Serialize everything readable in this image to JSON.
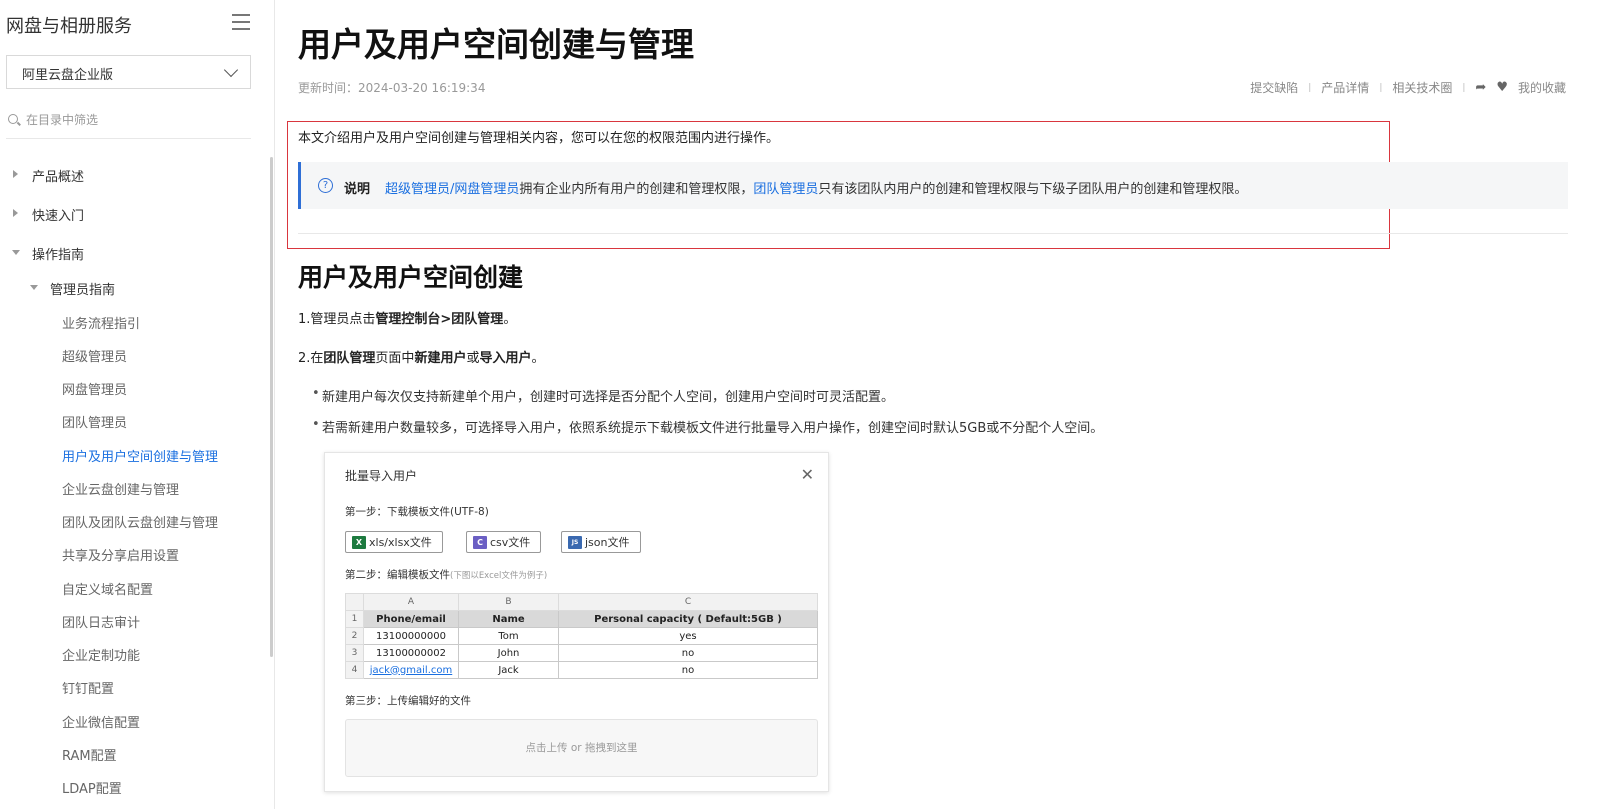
{
  "sidebar": {
    "title": "网盘与相册服务",
    "product_select": "阿里云盘企业版",
    "filter_placeholder": "在目录中筛选",
    "items": [
      {
        "label": "产品概述"
      },
      {
        "label": "快速入门"
      },
      {
        "label": "操作指南"
      },
      {
        "label": "管理员指南"
      },
      {
        "label": "业务流程指引"
      },
      {
        "label": "超级管理员"
      },
      {
        "label": "网盘管理员"
      },
      {
        "label": "团队管理员"
      },
      {
        "label": "用户及用户空间创建与管理"
      },
      {
        "label": "企业云盘创建与管理"
      },
      {
        "label": "团队及团队云盘创建与管理"
      },
      {
        "label": "共享及分享启用设置"
      },
      {
        "label": "自定义域名配置"
      },
      {
        "label": "团队日志审计"
      },
      {
        "label": "企业定制功能"
      },
      {
        "label": "钉钉配置"
      },
      {
        "label": "企业微信配置"
      },
      {
        "label": "RAM配置"
      },
      {
        "label": "LDAP配置"
      }
    ]
  },
  "article": {
    "title": "用户及用户空间创建与管理",
    "updated": "更新时间：2024-03-20 16:19:34",
    "actions": {
      "report": "提交缺陷",
      "product": "产品详情",
      "community": "相关技术圈",
      "favorite": "我的收藏"
    },
    "intro": "本文介绍用户及用户空间创建与管理相关内容，您可以在您的权限范围内进行操作。",
    "note": {
      "label": "说明",
      "link1": "超级管理员/网盘管理员",
      "text1": "拥有企业内所有用户的创建和管理权限，",
      "link2": "团队管理员",
      "text2": "只有该团队内用户的创建和管理权限与下级子团队用户的创建和管理权限。"
    },
    "section_title": "用户及用户空间创建",
    "step1": {
      "prefix": "1.管理员点击",
      "bold": "管理控制台>团队管理",
      "suffix": "。"
    },
    "step2": {
      "prefix": "2.在",
      "bold1": "团队管理",
      "mid": "页面中",
      "bold2": "新建用户",
      "or": "或",
      "bold3": "导入用户",
      "suffix": "。"
    },
    "bullets": [
      "新建用户每次仅支持新建单个用户，创建时可选择是否分配个人空间，创建用户空间时可灵活配置。",
      "若需新建用户数量较多，可选择导入用户，依照系统提示下载模板文件进行批量导入用户操作，创建空间时默认5GB或不分配个人空间。"
    ]
  },
  "dialog": {
    "title": "批量导入用户",
    "step1": "第一步：下载模板文件(UTF-8)",
    "buttons": [
      {
        "icon": "excel-file-icon",
        "label": "xls/xlsx文件"
      },
      {
        "icon": "csv-file-icon",
        "label": "csv文件"
      },
      {
        "icon": "json-file-icon",
        "label": "json文件"
      }
    ],
    "step2": "第二步：编辑模板文件",
    "step2_hint": "(下图以Excel文件为例子)",
    "sheet": {
      "col_letters": [
        "A",
        "B",
        "C"
      ],
      "row_numbers": [
        "1",
        "2",
        "3",
        "4"
      ],
      "headers": [
        "Phone/email",
        "Name",
        "Personal capacity ( Default:5GB )"
      ],
      "rows": [
        [
          "13100000000",
          "Tom",
          "yes"
        ],
        [
          "13100000002",
          "John",
          "no"
        ],
        [
          "jack@gmail.com",
          "Jack",
          "no"
        ]
      ]
    },
    "step3": "第三步：上传编辑好的文件",
    "upload_text": "点击上传 or 拖拽到这里"
  },
  "colors": {
    "accent": "#1a6fe0",
    "highlight_border": "#d9363e",
    "note_bar": "#2f6fd6"
  }
}
